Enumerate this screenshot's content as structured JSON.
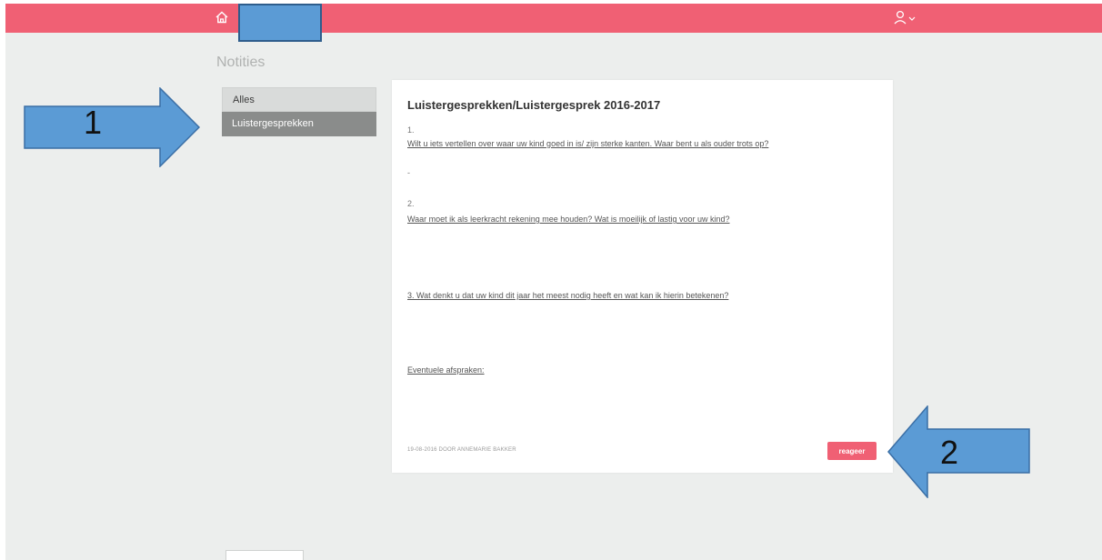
{
  "header": {
    "home_icon": "home-icon",
    "user_icon": "user-icon",
    "chevron_icon": "chevron-down-icon",
    "accent_color": "#f06074"
  },
  "page": {
    "title": "Notities"
  },
  "menu": {
    "items": [
      {
        "label": "Alles",
        "active": false
      },
      {
        "label": "Luistergesprekken",
        "active": true
      }
    ]
  },
  "note": {
    "title": "Luistergesprekken/Luistergesprek 2016-2017",
    "q1_num": "1.",
    "q1_text": "Wilt u iets vertellen over waar uw kind goed in is/ zijn sterke kanten. Waar bent u als ouder trots op?",
    "q1_answer": "-",
    "q2_num": "2.",
    "q2_text": "Waar moet ik als leerkracht rekening mee houden? Wat is moeilijk of lastig voor uw kind?",
    "q3_text": "3. Wat denkt u dat uw kind dit jaar het meest nodig heeft en wat kan ik hierin betekenen?",
    "agreements_label": "Eventuele afspraken:",
    "meta": "19-08-2016 DOOR ANNEMARIE BAKKER",
    "reply_label": "reageer"
  },
  "annotations": {
    "arrow1_label": "1",
    "arrow2_label": "2",
    "arrow_color": "#5b9bd5"
  }
}
